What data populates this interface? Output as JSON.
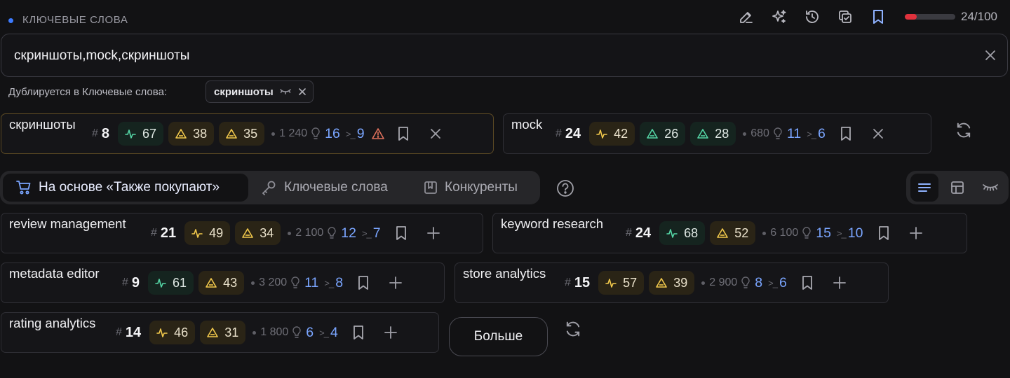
{
  "header": {
    "title": "КЛЮЧЕВЫЕ СЛОВА",
    "counter": "24/100",
    "progress": 0.24
  },
  "input": {
    "value": "скриншоты,mock,скриншоты"
  },
  "duplicate": {
    "label": "Дублируется в Ключевые слова:",
    "chip": "скриншоты"
  },
  "selected": [
    {
      "name": "скриншоты",
      "count": "8",
      "pills": [
        {
          "kind": "g",
          "icon": "pulse",
          "value": "67"
        },
        {
          "kind": "y",
          "icon": "tri",
          "value": "38"
        },
        {
          "kind": "y",
          "icon": "tri",
          "value": "35"
        }
      ],
      "volume": "1 240",
      "ideas": "16",
      "pos": "9",
      "warn": true
    },
    {
      "name": "mock",
      "count": "24",
      "pills": [
        {
          "kind": "y",
          "icon": "pulse",
          "value": "42"
        },
        {
          "kind": "g",
          "icon": "tri",
          "value": "26"
        },
        {
          "kind": "g",
          "icon": "tri",
          "value": "28"
        }
      ],
      "volume": "680",
      "ideas": "11",
      "pos": "6",
      "warn": false
    }
  ],
  "tabs": [
    {
      "label": "На основе «Также покупают»",
      "icon": "cart-icon"
    },
    {
      "label": "Ключевые слова",
      "icon": "key-icon"
    },
    {
      "label": "Конкуренты",
      "icon": "book-icon"
    }
  ],
  "suggestions": [
    {
      "name": "review management",
      "count": "21",
      "pills": [
        {
          "kind": "y",
          "icon": "pulse",
          "value": "49"
        },
        {
          "kind": "y",
          "icon": "tri",
          "value": "34"
        }
      ],
      "volume": "2 100",
      "ideas": "12",
      "pos": "7"
    },
    {
      "name": "keyword research",
      "count": "24",
      "pills": [
        {
          "kind": "g",
          "icon": "pulse",
          "value": "68"
        },
        {
          "kind": "y",
          "icon": "tri",
          "value": "52"
        }
      ],
      "volume": "6 100",
      "ideas": "15",
      "pos": "10"
    },
    {
      "name": "metadata editor",
      "count": "9",
      "pills": [
        {
          "kind": "g",
          "icon": "pulse",
          "value": "61"
        },
        {
          "kind": "y",
          "icon": "tri",
          "value": "43"
        }
      ],
      "volume": "3 200",
      "ideas": "11",
      "pos": "8"
    },
    {
      "name": "store analytics",
      "count": "15",
      "pills": [
        {
          "kind": "y",
          "icon": "pulse",
          "value": "57"
        },
        {
          "kind": "y",
          "icon": "tri",
          "value": "39"
        }
      ],
      "volume": "2 900",
      "ideas": "8",
      "pos": "6"
    },
    {
      "name": "rating analytics",
      "count": "14",
      "pills": [
        {
          "kind": "y",
          "icon": "pulse",
          "value": "46"
        },
        {
          "kind": "y",
          "icon": "tri",
          "value": "31"
        }
      ],
      "volume": "1 800",
      "ideas": "6",
      "pos": "4"
    }
  ],
  "more_label": "Больше",
  "colors": {
    "accent": "#3d7bff",
    "green": "#55d6a6",
    "yellow": "#f2c94c",
    "warn": "#e0715c",
    "blue": "#7aa5ff"
  }
}
